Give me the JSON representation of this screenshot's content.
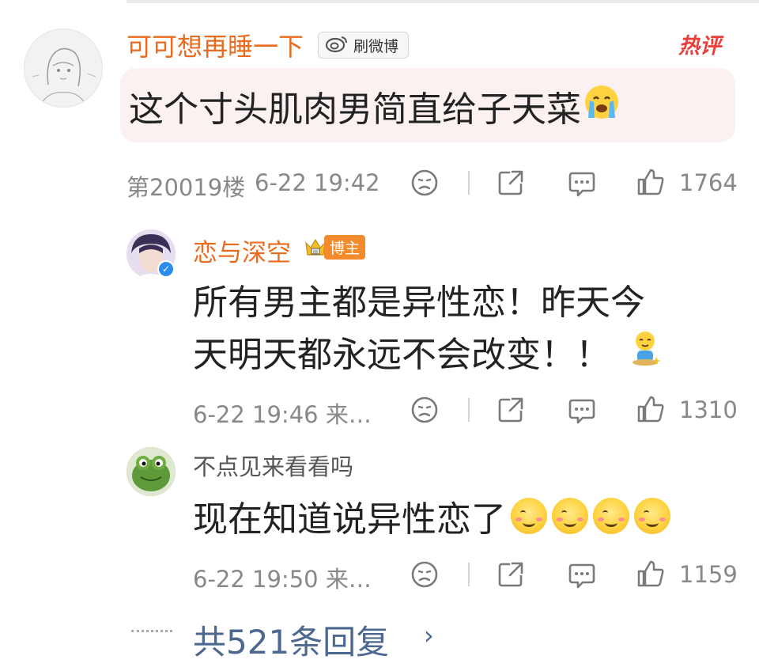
{
  "comment": {
    "username": "可可想再睡一下",
    "badge_label": "刷微博",
    "hot_label": "热评",
    "text": "这个寸头肌肉男简直给子天菜",
    "floor": "第20019楼",
    "time": "6-22 19:42",
    "likes": "1764"
  },
  "replies": [
    {
      "username": "恋与深空",
      "role_badge": "博主",
      "text_line1": "所有男主都是异性恋！昨天今",
      "text_line2": "天明天都永远不会改变！！",
      "time": "6-22 19:46 来…",
      "likes": "1310"
    },
    {
      "username": "不点见来看看吗",
      "text": "现在知道说异性恋了",
      "time": "6-22 19:50 来…",
      "likes": "1159"
    }
  ],
  "footer": {
    "more_replies": "共521条回复",
    "chevron": "›"
  },
  "icons": [
    "weibo-icon",
    "crying-emoji",
    "dislike-icon",
    "share-icon",
    "comment-icon",
    "like-icon",
    "crown-icon",
    "verified-icon",
    "sitting-emoji",
    "smile-emoji",
    "chevron-right-icon"
  ],
  "colors": {
    "username_orange": "#e86b1f",
    "hot_red": "#e8403a",
    "link_blue": "#4d6890",
    "meta_gray": "#888888",
    "bubble_bg": "#fbf1f1"
  }
}
